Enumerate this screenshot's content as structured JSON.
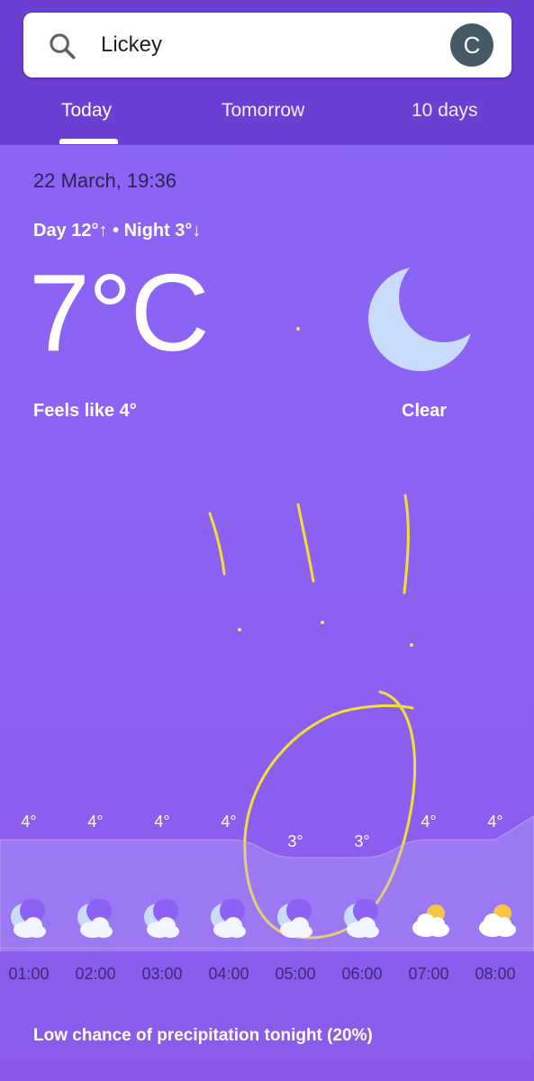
{
  "search": {
    "query": "Lickey"
  },
  "account": {
    "avatar_letter": "C"
  },
  "tabs": [
    {
      "label": "Today",
      "selected": true
    },
    {
      "label": "Tomorrow",
      "selected": false
    },
    {
      "label": "10 days",
      "selected": false
    }
  ],
  "current": {
    "date_time": "22 March, 19:36",
    "day_night": "Day 12°↑ • Night 3°↓",
    "temperature": "7°C",
    "feels_like": "Feels like 4°",
    "condition": "Clear",
    "condition_icon": "moon-icon"
  },
  "hourly": [
    {
      "time": "01:00",
      "temp": "4°",
      "value": 4,
      "icon": "moon-cloud-icon"
    },
    {
      "time": "02:00",
      "temp": "4°",
      "value": 4,
      "icon": "moon-cloud-icon"
    },
    {
      "time": "03:00",
      "temp": "4°",
      "value": 4,
      "icon": "moon-cloud-icon"
    },
    {
      "time": "04:00",
      "temp": "4°",
      "value": 4,
      "icon": "moon-cloud-icon"
    },
    {
      "time": "05:00",
      "temp": "3°",
      "value": 3,
      "icon": "moon-cloud-icon"
    },
    {
      "time": "06:00",
      "temp": "3°",
      "value": 3,
      "icon": "moon-cloud-icon"
    },
    {
      "time": "07:00",
      "temp": "4°",
      "value": 4,
      "icon": "sun-cloud-icon"
    },
    {
      "time": "08:00",
      "temp": "4°",
      "value": 4,
      "icon": "sun-cloud-icon"
    }
  ],
  "precipitation_note": "Low chance of precipitation tonight (20%)",
  "colors": {
    "header": "#6a3fd3",
    "annotation": "#f3e030",
    "moon": "#c9dcfb"
  }
}
